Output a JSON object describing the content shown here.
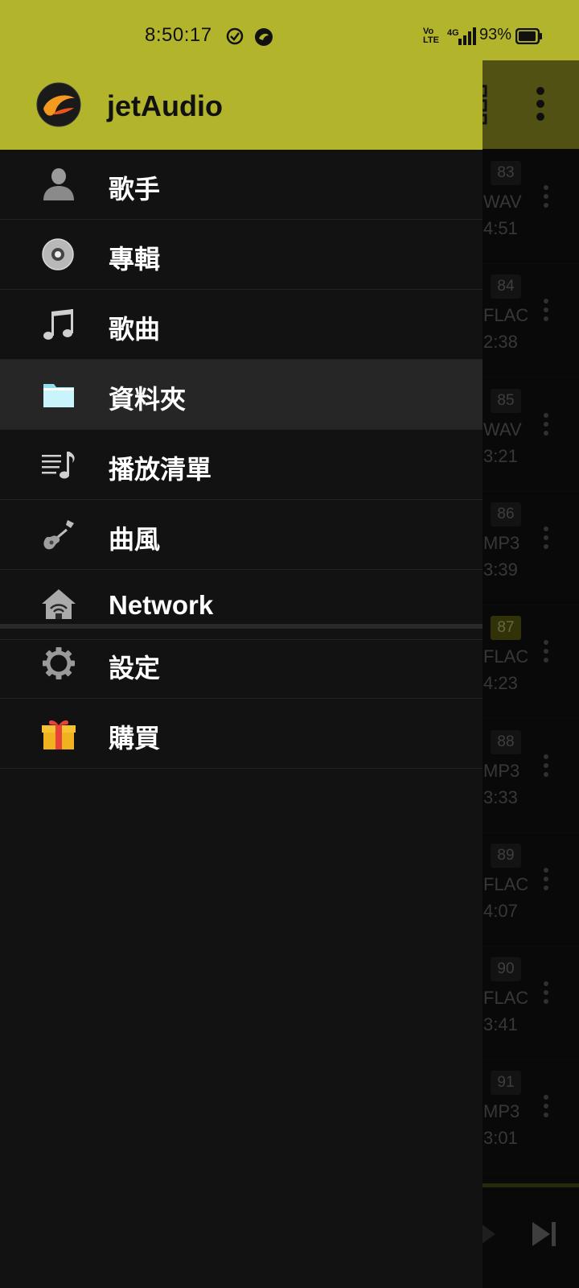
{
  "status_bar": {
    "time": "8:50:17",
    "volte_line1": "Vo",
    "volte_line2": "LTE",
    "network": "4G",
    "battery": "93%"
  },
  "drawer": {
    "app_title": "jetAudio",
    "items": [
      {
        "label": "歌手",
        "icon": "artist-icon"
      },
      {
        "label": "專輯",
        "icon": "album-icon"
      },
      {
        "label": "歌曲",
        "icon": "music-note-icon"
      },
      {
        "label": "資料夾",
        "icon": "folder-icon",
        "selected": true
      },
      {
        "label": "播放清單",
        "icon": "playlist-icon"
      },
      {
        "label": "曲風",
        "icon": "guitar-icon"
      },
      {
        "label": "Network",
        "icon": "home-network-icon"
      }
    ],
    "secondary_items": [
      {
        "label": "設定",
        "icon": "gear-icon"
      },
      {
        "label": "購買",
        "icon": "gift-icon"
      }
    ]
  },
  "background_list": {
    "rows": [
      {
        "num": "83",
        "format": "WAV",
        "duration": "4:51"
      },
      {
        "num": "84",
        "format": "FLAC",
        "duration": "2:38"
      },
      {
        "num": "85",
        "format": "WAV",
        "duration": "3:21"
      },
      {
        "num": "86",
        "format": "MP3",
        "duration": "3:39"
      },
      {
        "num": "87",
        "format": "FLAC",
        "duration": "4:23",
        "playing": true
      },
      {
        "num": "88",
        "format": "MP3",
        "duration": "3:33"
      },
      {
        "num": "89",
        "format": "FLAC",
        "duration": "4:07"
      },
      {
        "num": "90",
        "format": "FLAC",
        "duration": "3:41"
      },
      {
        "num": "91",
        "format": "MP3",
        "duration": "3:01"
      }
    ]
  },
  "colors": {
    "accent": "#b2b42c",
    "drawer_bg": "#121212",
    "selected_bg": "#262626"
  }
}
